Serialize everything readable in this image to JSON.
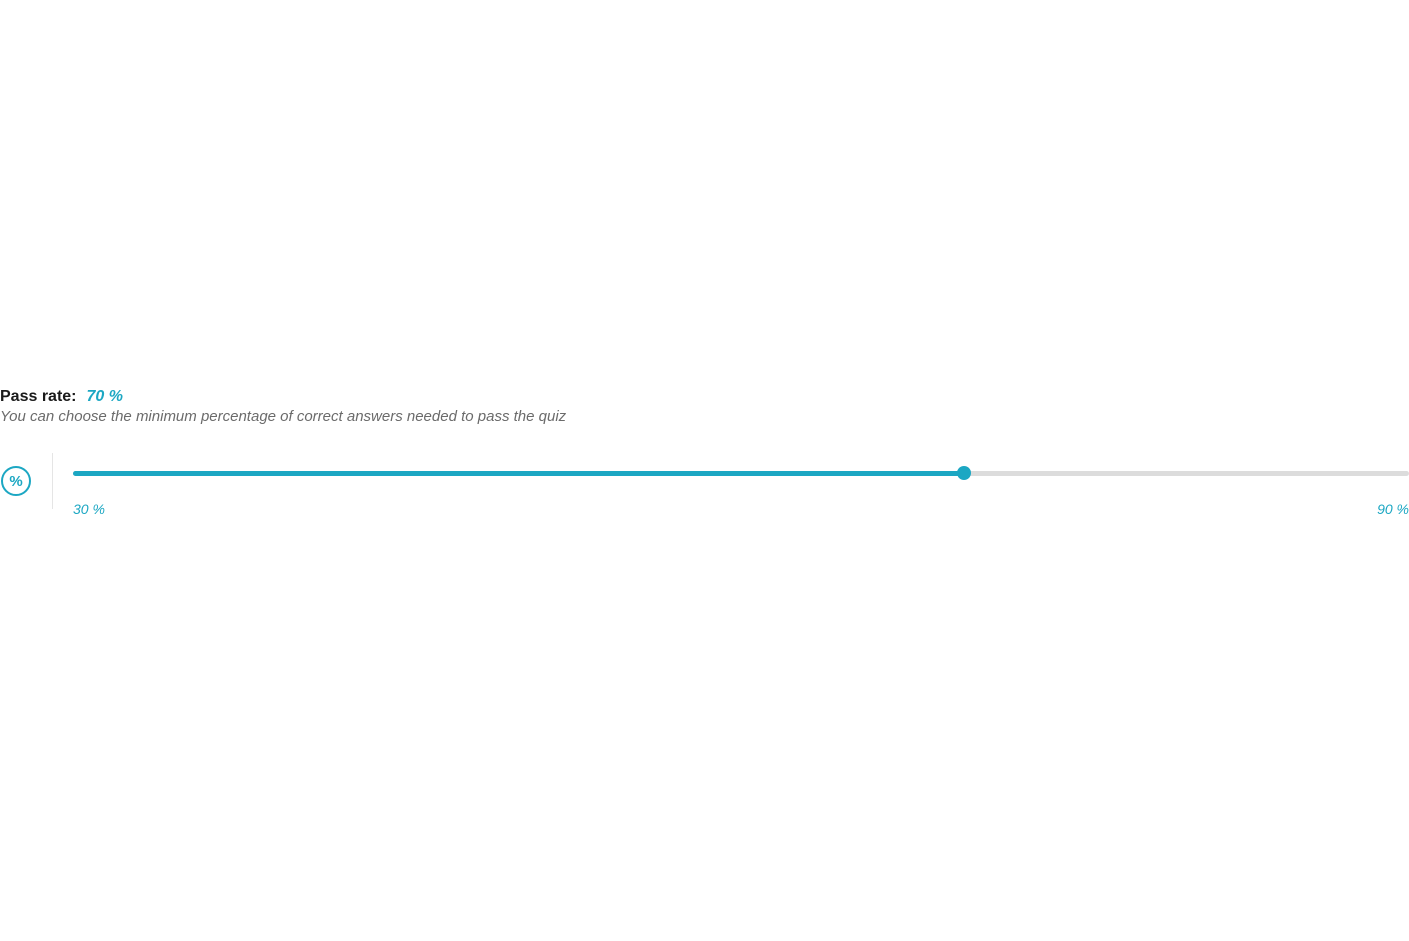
{
  "passRate": {
    "label": "Pass rate:",
    "value": "70 %",
    "description": "You can choose the minimum percentage of correct answers needed to pass the quiz",
    "slider": {
      "min": 30,
      "max": 90,
      "current": 70,
      "minLabel": "30 %",
      "maxLabel": "90 %",
      "fillPercent": "66.67%",
      "thumbPercent": "66.67%"
    },
    "iconGlyph": "%"
  },
  "colors": {
    "accent": "#1ca7c3",
    "textMuted": "#6b6b6b",
    "trackBg": "#dcdcdc"
  }
}
